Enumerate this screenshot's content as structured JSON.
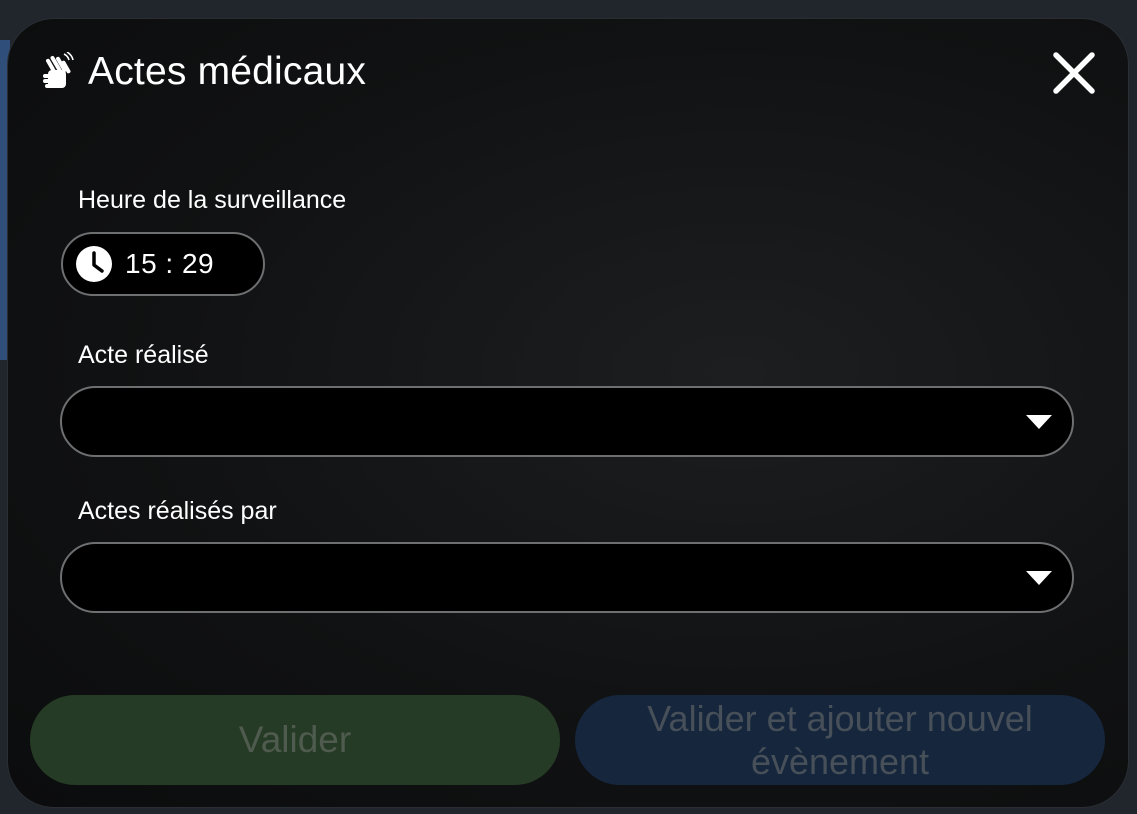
{
  "dialog": {
    "title": "Actes médicaux",
    "icon": "hand-wave-icon",
    "close_icon": "close-icon"
  },
  "fields": {
    "time": {
      "label": "Heure de la surveillance",
      "value": "15 : 29",
      "icon": "clock-icon"
    },
    "act": {
      "label": "Acte réalisé",
      "value": "",
      "icon": "caret-down-icon"
    },
    "performed_by": {
      "label": "Actes réalisés par",
      "value": "",
      "icon": "caret-down-icon"
    }
  },
  "buttons": {
    "validate": "Valider",
    "validate_and_add": "Valider et ajouter nouvel évènement"
  },
  "colors": {
    "validate_button": "#263b25",
    "validate_add_button": "#16273d",
    "field_border": "#6e6f70"
  }
}
